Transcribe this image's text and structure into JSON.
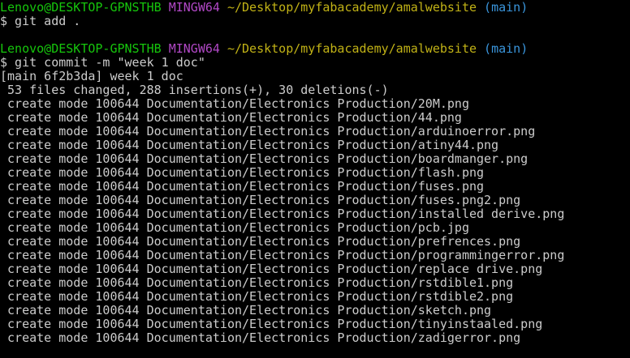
{
  "prompt1": {
    "user": "Lenovo@DESKTOP-GPNSTHB",
    "env": "MINGW64",
    "path": "~/Desktop/myfabacademy/amalwebsite",
    "branch": "(main)"
  },
  "command1": "$ git add .",
  "prompt2": {
    "user": "Lenovo@DESKTOP-GPNSTHB",
    "env": "MINGW64",
    "path": "~/Desktop/myfabacademy/amalwebsite",
    "branch": "(main)"
  },
  "command2": "$ git commit -m \"week 1 doc\"",
  "commit_summary": "[main 6f2b3da] week 1 doc",
  "stats": " 53 files changed, 288 insertions(+), 30 deletions(-)",
  "create_lines": [
    " create mode 100644 Documentation/Electronics Production/20M.png",
    " create mode 100644 Documentation/Electronics Production/44.png",
    " create mode 100644 Documentation/Electronics Production/arduinoerror.png",
    " create mode 100644 Documentation/Electronics Production/atiny44.png",
    " create mode 100644 Documentation/Electronics Production/boardmanger.png",
    " create mode 100644 Documentation/Electronics Production/flash.png",
    " create mode 100644 Documentation/Electronics Production/fuses.png",
    " create mode 100644 Documentation/Electronics Production/fuses.png2.png",
    " create mode 100644 Documentation/Electronics Production/installed derive.png",
    " create mode 100644 Documentation/Electronics Production/pcb.jpg",
    " create mode 100644 Documentation/Electronics Production/prefrences.png",
    " create mode 100644 Documentation/Electronics Production/programmingerror.png",
    " create mode 100644 Documentation/Electronics Production/replace drive.png",
    " create mode 100644 Documentation/Electronics Production/rstdible1.png",
    " create mode 100644 Documentation/Electronics Production/rstdible2.png",
    " create mode 100644 Documentation/Electronics Production/sketch.png",
    " create mode 100644 Documentation/Electronics Production/tinyinstaaled.png",
    " create mode 100644 Documentation/Electronics Production/zadigerror.png"
  ]
}
